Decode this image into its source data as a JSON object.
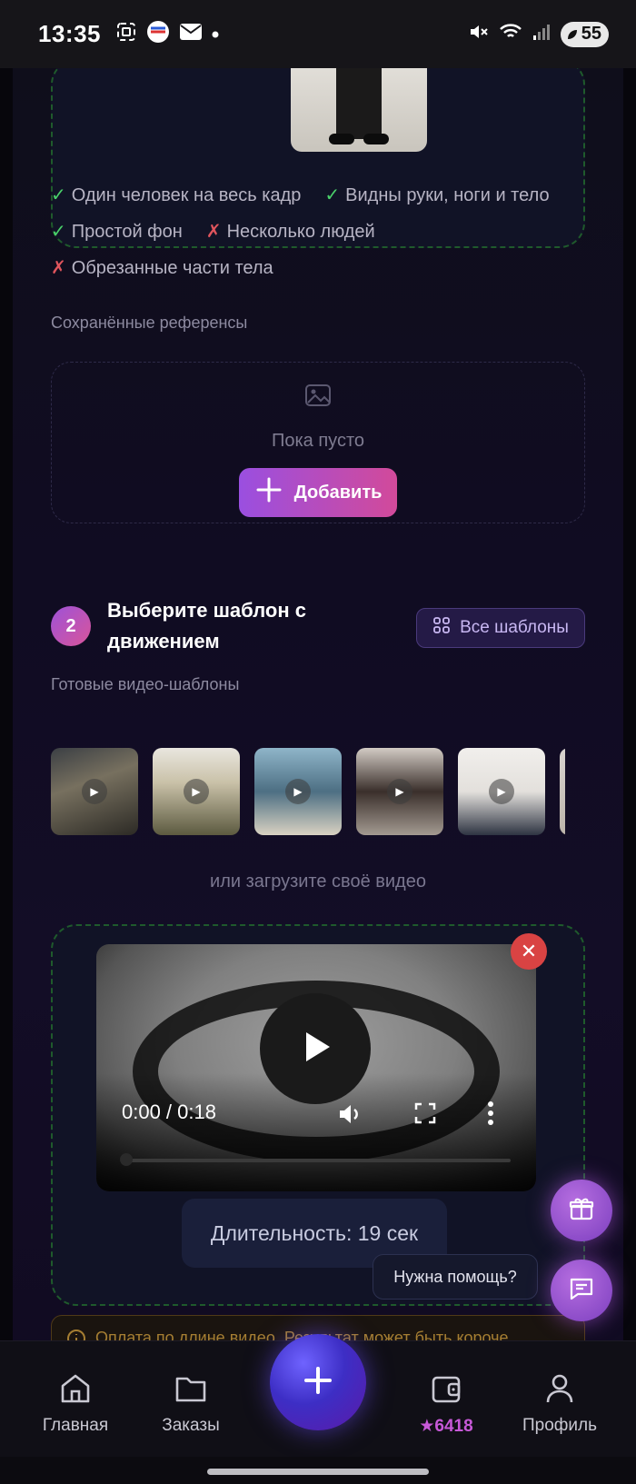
{
  "status_bar": {
    "time": "13:35",
    "battery": "55",
    "icons": [
      "screenshot-icon",
      "gosuslugi-icon",
      "mail-icon",
      "dot-icon",
      "mute-icon",
      "wifi-icon",
      "signal-icon",
      "battery-icon"
    ]
  },
  "reference_rules": {
    "rules": [
      {
        "mark": "✓",
        "text": "Один человек на весь кадр",
        "type": "ok"
      },
      {
        "mark": "✓",
        "text": "Видны руки, ноги и тело",
        "type": "ok"
      },
      {
        "mark": "✓",
        "text": "Простой фон",
        "type": "ok"
      },
      {
        "mark": "✗",
        "text": "Несколько людей",
        "type": "bad"
      },
      {
        "mark": "✗",
        "text": "Обрезанные части тела",
        "type": "bad"
      }
    ]
  },
  "saved_refs": {
    "label": "Сохранённые референсы",
    "empty_text": "Пока пусто",
    "add_label": "Добавить"
  },
  "step2": {
    "number": "2",
    "title": "Выберите шаблон с движением",
    "all_templates_label": "Все шаблоны",
    "ready_label": "Готовые видео-шаблоны",
    "or_upload": "или загрузите своё видео"
  },
  "video": {
    "timecode": "0:00 / 0:18",
    "duration_label": "Длительность: 19 сек",
    "notice": "Оплата по длине видео. Результат может быть короче"
  },
  "help": {
    "bubble": "Нужна помощь?"
  },
  "bottom_nav": {
    "home": "Главная",
    "orders": "Заказы",
    "stars": "6418",
    "profile": "Профиль"
  },
  "colors": {
    "accent_gradient_start": "#9a4fe0",
    "accent_gradient_end": "#d24a9a",
    "ok": "#4ad06a",
    "bad": "#e0555d",
    "dashed_border": "#1f5a2c"
  }
}
